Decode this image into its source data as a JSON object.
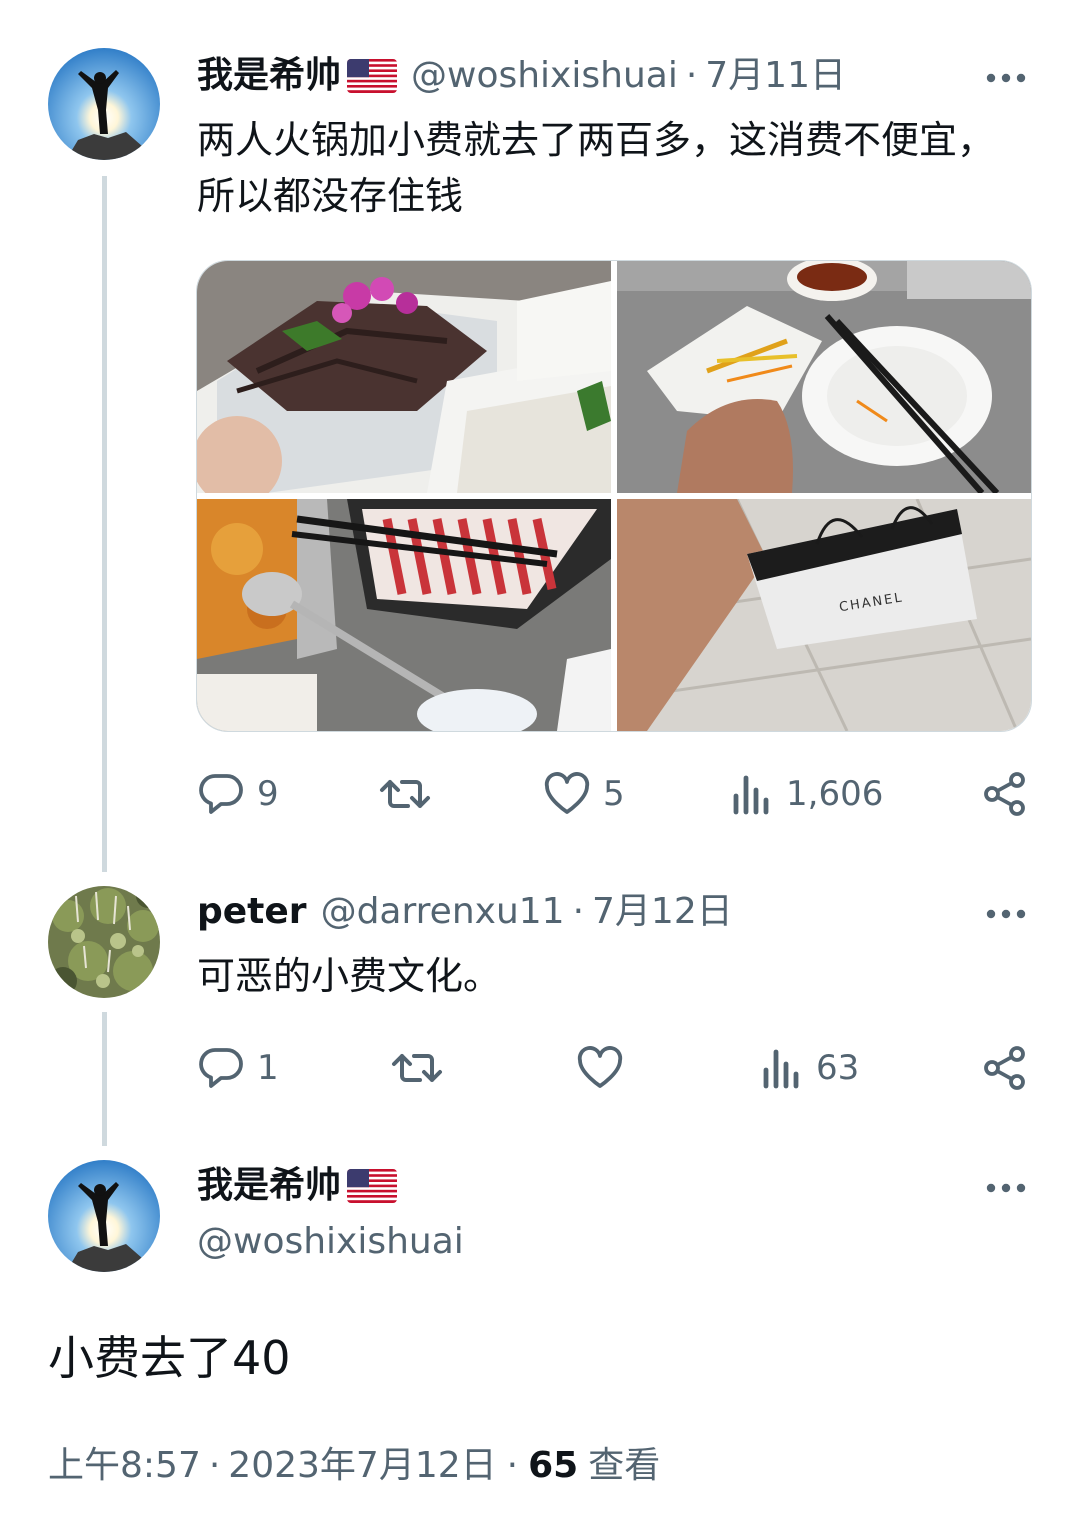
{
  "posts": [
    {
      "name": "我是希帅",
      "handle": "@woshixishuai",
      "separator": "·",
      "date": "7月11日",
      "text": "两人火锅加小费就去了两百多，这消费不便宜，所以都没存住钱",
      "stats": {
        "replies": "9",
        "retweets": "",
        "likes": "5",
        "views": "1,606"
      },
      "media_label": "CHANEL"
    },
    {
      "name": "peter",
      "handle": "@darrenxu11",
      "separator": "·",
      "date": "7月12日",
      "text": "可恶的小费文化。",
      "stats": {
        "replies": "1",
        "retweets": "",
        "likes": "",
        "views": "63"
      }
    }
  ],
  "main": {
    "name": "我是希帅",
    "handle": "@woshixishuai",
    "text": "小费去了40",
    "time": "上午8:57",
    "separator": "·",
    "date": "2023年7月12日",
    "view_count": "65",
    "views_label": "查看"
  },
  "icons": {
    "more": "more-horizontal-icon",
    "reply": "reply-icon",
    "retweet": "retweet-icon",
    "like": "heart-icon",
    "views": "views-icon",
    "share": "share-icon",
    "flag": "us-flag-icon"
  },
  "colors": {
    "text": "#0f1419",
    "secondary": "#536471",
    "thread_line": "#cfd9de",
    "background": "#ffffff"
  }
}
